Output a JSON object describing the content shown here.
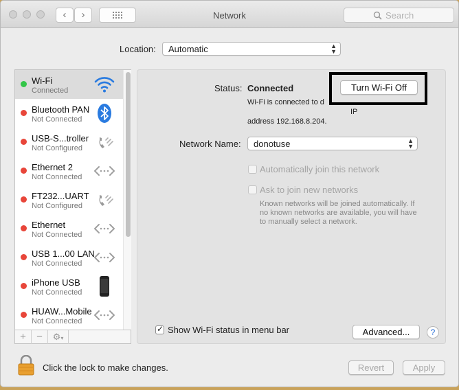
{
  "window": {
    "title": "Network"
  },
  "search": {
    "placeholder": "Search"
  },
  "location": {
    "label": "Location:",
    "value": "Automatic"
  },
  "sidebar": {
    "items": [
      {
        "name": "Wi-Fi",
        "status": "Connected",
        "dot": "#33c648",
        "icon": "wifi-icon",
        "selected": true
      },
      {
        "name": "Bluetooth PAN",
        "status": "Not Connected",
        "dot": "#e8463a",
        "icon": "bluetooth-icon"
      },
      {
        "name": "USB-S...troller",
        "status": "Not Configured",
        "dot": "#e8463a",
        "icon": "phone-handset-icon"
      },
      {
        "name": "Ethernet 2",
        "status": "Not Connected",
        "dot": "#e8463a",
        "icon": "ethernet-arrows-icon"
      },
      {
        "name": "FT232...UART",
        "status": "Not Configured",
        "dot": "#e8463a",
        "icon": "phone-handset-icon"
      },
      {
        "name": "Ethernet",
        "status": "Not Connected",
        "dot": "#e8463a",
        "icon": "ethernet-arrows-icon"
      },
      {
        "name": "USB 1...00 LAN",
        "status": "Not Connected",
        "dot": "#e8463a",
        "icon": "ethernet-arrows-icon"
      },
      {
        "name": "iPhone USB",
        "status": "Not Connected",
        "dot": "#e8463a",
        "icon": "iphone-icon"
      },
      {
        "name": "HUAW...Mobile",
        "status": "Not Connected",
        "dot": "#e8463a",
        "icon": "ethernet-arrows-icon"
      }
    ],
    "tools": {
      "add": "+",
      "remove": "−",
      "gear": "⚙"
    }
  },
  "detail": {
    "status_label": "Status:",
    "status_value": "Connected",
    "turn_off_button": "Turn Wi-Fi Off",
    "status_desc_line1": "Wi-Fi is connected to d",
    "status_desc_line1_end": "IP",
    "status_desc_line2": "address 192.168.8.204.",
    "network_name_label": "Network Name:",
    "network_name_value": "donotuse",
    "auto_join_label": "Automatically join this network",
    "ask_join_label": "Ask to join new networks",
    "ask_join_note": "Known networks will be joined automatically. If no known networks are available, you will have to manually select a network.",
    "show_status_label": "Show Wi-Fi status in menu bar",
    "show_status_checked": true,
    "advanced_button": "Advanced...",
    "help_button": "?"
  },
  "footer": {
    "lock_text": "Click the lock to make changes.",
    "revert_button": "Revert",
    "apply_button": "Apply"
  }
}
